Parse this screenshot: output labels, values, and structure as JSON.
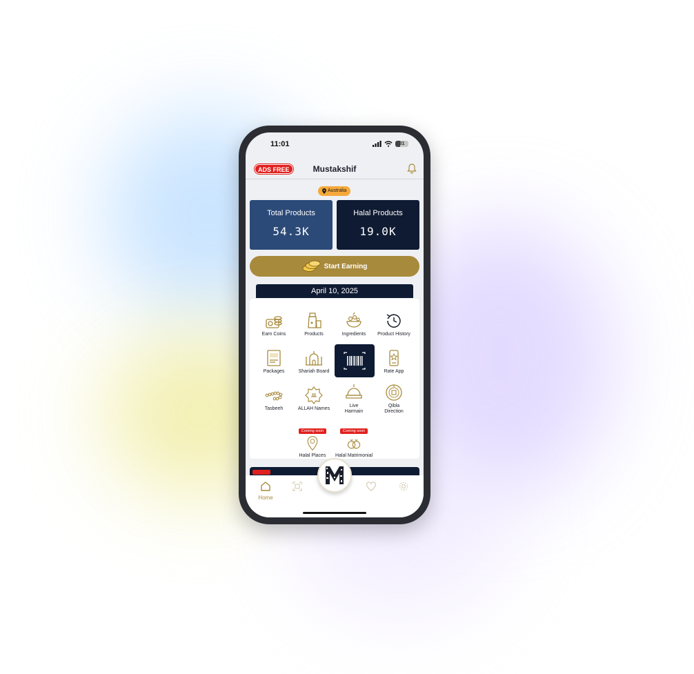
{
  "status_bar": {
    "time": "11:01",
    "battery": "31"
  },
  "header": {
    "ads_free": "ADS FREE",
    "title": "Mustakshif"
  },
  "location": {
    "label": "Australia"
  },
  "stats": {
    "total": {
      "label": "Total Products",
      "value": "54.3K"
    },
    "halal": {
      "label": "Halal Products",
      "value": "19.0K"
    }
  },
  "earn_button": {
    "label": "Start Earning"
  },
  "date_bar": {
    "date": "April 10, 2025"
  },
  "menu": {
    "earn_coins": "Earn Coins",
    "products": "Products",
    "ingredients": "Ingredients",
    "product_history": "Product History",
    "packages": "Packages",
    "shariah_board": "Shariah Board",
    "rate_app": "Rate App",
    "tasbeeh": "Tasbeeh",
    "allah_names": "ALLAH Names",
    "live_harmain_1": "Live",
    "live_harmain_2": "Harmain",
    "qibla_1": "Qibla",
    "qibla_2": "Direction",
    "halal_places": "Halal Places",
    "halal_matrimonial": "Halal Matrimonial",
    "coming_soon": "Coming soon"
  },
  "tabbar": {
    "home": "Home",
    "fab_letter": "M"
  },
  "colors": {
    "gold": "#a88a3c",
    "navy": "#0f1b33",
    "blue": "#2c4a78",
    "red": "#e0201e",
    "orange": "#f5a93a"
  }
}
